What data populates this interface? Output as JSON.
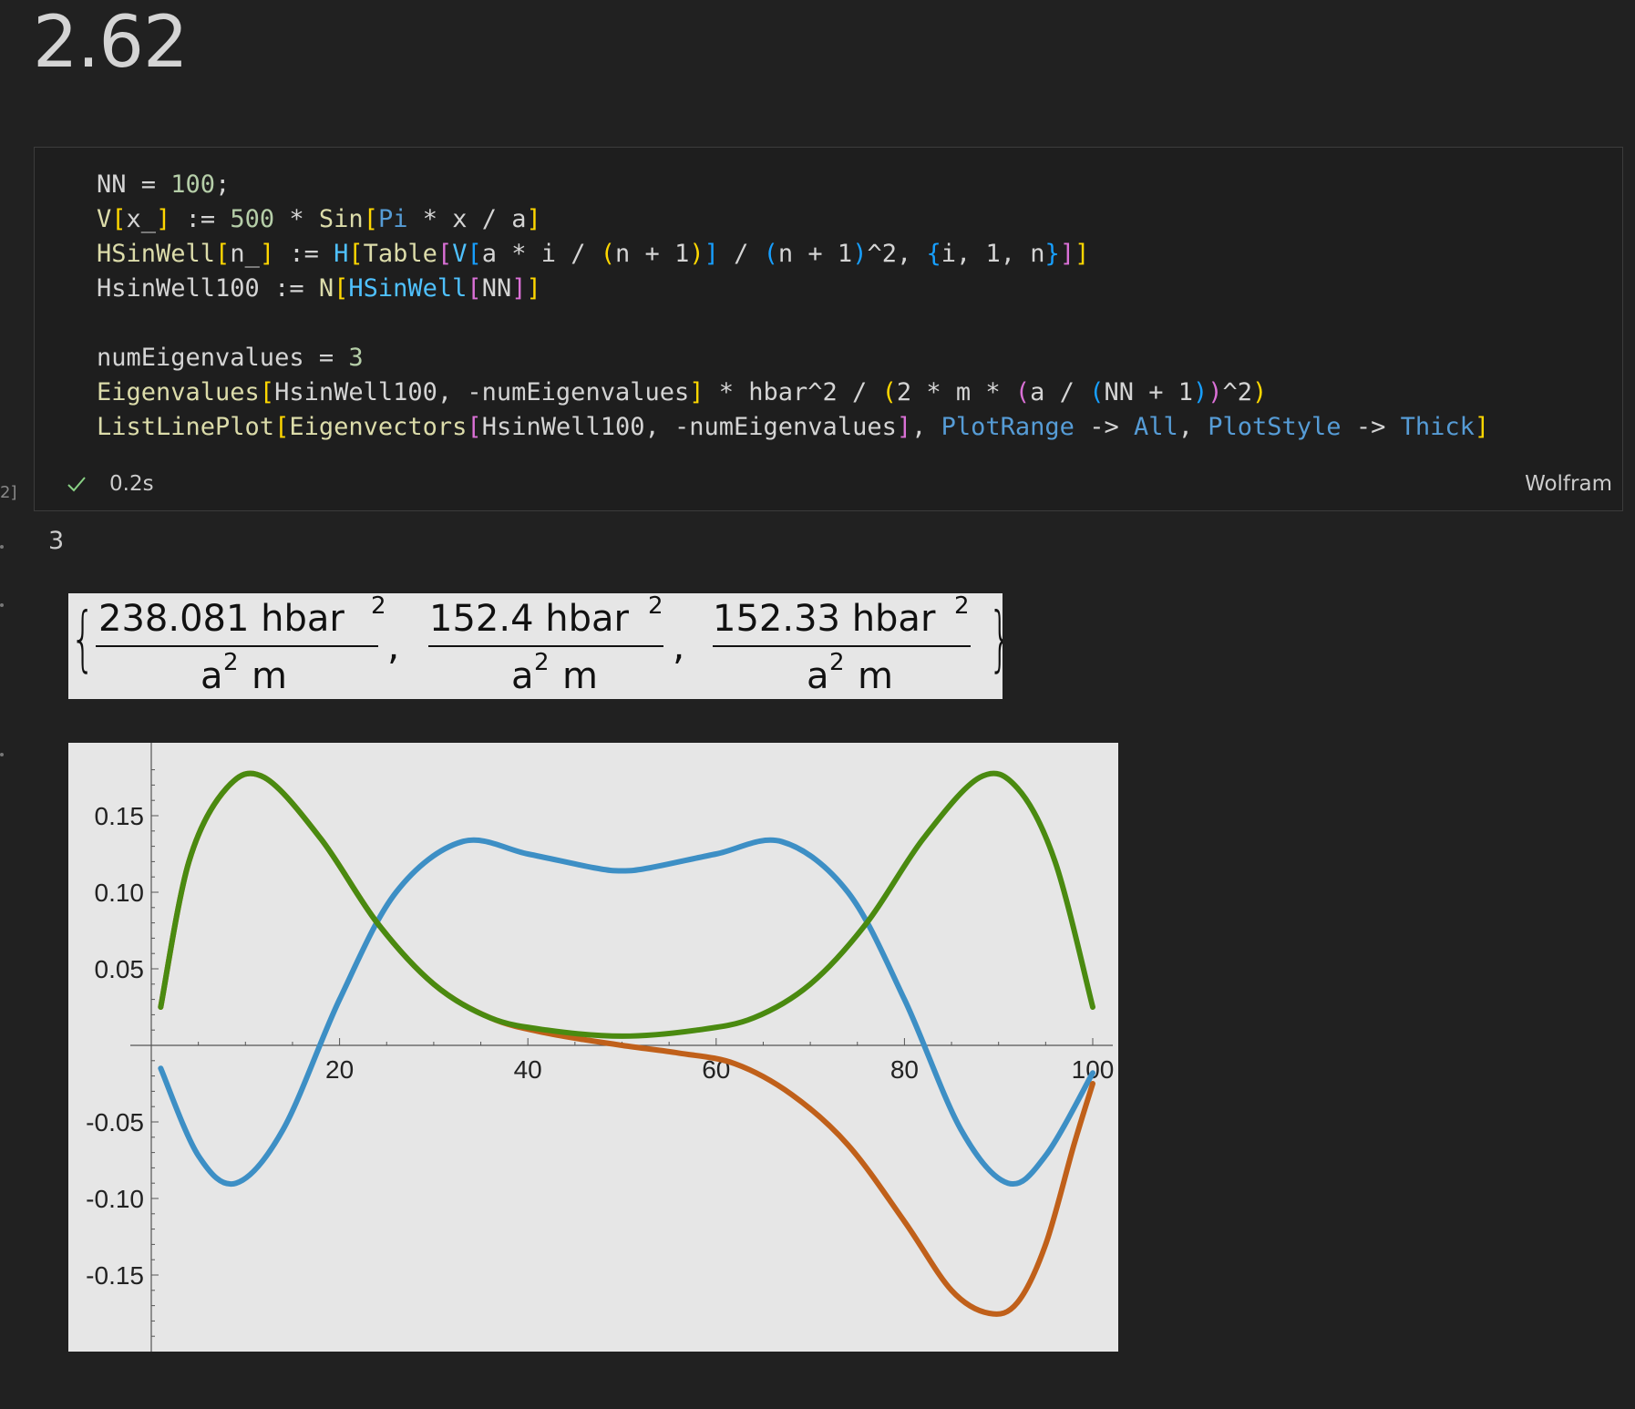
{
  "heading": "2.62",
  "cell": {
    "execution_count": "2]",
    "status_time": "0.2s",
    "language": "Wolfram",
    "code": {
      "line1": {
        "a": "NN",
        "b": " = ",
        "c": "100",
        "d": ";"
      },
      "line2": {
        "a": "V",
        "b": "[",
        "c": "x_",
        "d": "]",
        "e": " := ",
        "f": "500",
        "g": " * ",
        "h": "Sin",
        "i": "[",
        "j": "Pi",
        "k": " * x / a",
        "l": "]"
      },
      "line3": {
        "a": "HSinWell",
        "b": "[",
        "c": "n_",
        "d": "]",
        "e": " := ",
        "f": "H",
        "g": "[",
        "h": "Table",
        "i": "[",
        "j": "V",
        "k": "[",
        "l": "a * i / ",
        "m": "(",
        "n": "n + 1",
        "o": ")",
        "p": "]",
        "q": " / ",
        "r": "(",
        "s": "n + 1",
        "t": ")",
        "u": "^2, ",
        "v": "{",
        "w": "i, 1, n",
        "x": "}",
        "y": "]",
        "z": "]"
      },
      "line4": {
        "a": "HsinWell100",
        "b": " := ",
        "c": "N",
        "d": "[",
        "e": "HSinWell",
        "f": "[",
        "g": "NN",
        "h": "]",
        "i": "]"
      },
      "line6": {
        "a": "numEigenvalues",
        "b": " = ",
        "c": "3"
      },
      "line7": {
        "a": "Eigenvalues",
        "b": "[",
        "c": "HsinWell100, -numEigenvalues",
        "d": "]",
        "e": " * hbar^2 / ",
        "f": "(",
        "g": "2 * m * ",
        "h": "(",
        "i": "a / ",
        "j": "(",
        "k": "NN + 1",
        "l": ")",
        "m": ")",
        "n": "^2",
        "o": ")"
      },
      "line8": {
        "a": "ListLinePlot",
        "b": "[",
        "c": "Eigenvectors",
        "d": "[",
        "e": "HsinWell100, -numEigenvalues",
        "f": "]",
        "g": ", ",
        "h": "PlotRange",
        "i": " -> ",
        "j": "All",
        "k": ", ",
        "l": "PlotStyle",
        "m": " -> ",
        "n": "Thick",
        "o": "]"
      }
    }
  },
  "outputs": {
    "value": "3",
    "eigenvalues": [
      {
        "coef": "238.081",
        "sym": "hbar",
        "pow": "2",
        "den_a": "a",
        "den_pow": "2",
        "den_m": "m"
      },
      {
        "coef": "152.4",
        "sym": "hbar",
        "pow": "2",
        "den_a": "a",
        "den_pow": "2",
        "den_m": "m"
      },
      {
        "coef": "152.33",
        "sym": "hbar",
        "pow": "2",
        "den_a": "a",
        "den_pow": "2",
        "den_m": "m"
      }
    ],
    "punct": {
      "open": "{",
      "close": "}",
      "comma": ","
    }
  },
  "colors": {
    "background": "#212121",
    "cell_bg": "#1e1e1e",
    "check": "#89d185",
    "plot_bg": "#e6e6e6",
    "series": [
      "#3d8fc5",
      "#c0601a",
      "#4a8a10"
    ]
  },
  "chart_data": {
    "type": "line",
    "xlim": [
      0,
      100
    ],
    "ylim": [
      -0.18,
      0.18
    ],
    "x_ticks": [
      "20",
      "40",
      "60",
      "80",
      "100"
    ],
    "y_ticks": [
      "0.15",
      "0.10",
      "0.05",
      "-0.05",
      "-0.10",
      "-0.15"
    ],
    "y_tick_values": [
      0.15,
      0.1,
      0.05,
      -0.05,
      -0.1,
      -0.15
    ],
    "x_tick_values": [
      20,
      40,
      60,
      80,
      100
    ],
    "grid": false,
    "legend": "none",
    "series": [
      {
        "x": [
          1,
          5,
          9,
          14,
          20,
          26,
          33,
          40,
          47,
          50,
          53,
          60,
          67,
          74,
          80,
          86,
          91,
          95,
          100
        ],
        "values": [
          -0.015,
          -0.072,
          -0.09,
          -0.055,
          0.03,
          0.1,
          0.133,
          0.125,
          0.116,
          0.114,
          0.116,
          0.125,
          0.133,
          0.1,
          0.03,
          -0.055,
          -0.09,
          -0.072,
          -0.018
        ]
      },
      {
        "x": [
          1,
          4,
          8,
          12,
          18,
          24,
          30,
          36,
          42,
          50,
          56,
          62,
          68,
          74,
          80,
          85,
          89,
          92,
          95,
          98,
          100
        ],
        "values": [
          0.025,
          0.12,
          0.168,
          0.175,
          0.135,
          0.08,
          0.04,
          0.018,
          0.008,
          0.0,
          -0.005,
          -0.012,
          -0.032,
          -0.065,
          -0.115,
          -0.16,
          -0.175,
          -0.168,
          -0.13,
          -0.065,
          -0.025
        ]
      },
      {
        "x": [
          1,
          4,
          8,
          12,
          18,
          24,
          30,
          36,
          42,
          50,
          58,
          64,
          70,
          76,
          82,
          88,
          92,
          96,
          100
        ],
        "values": [
          0.025,
          0.12,
          0.168,
          0.175,
          0.135,
          0.08,
          0.04,
          0.018,
          0.01,
          0.006,
          0.01,
          0.018,
          0.04,
          0.08,
          0.135,
          0.175,
          0.168,
          0.12,
          0.025
        ]
      }
    ]
  }
}
